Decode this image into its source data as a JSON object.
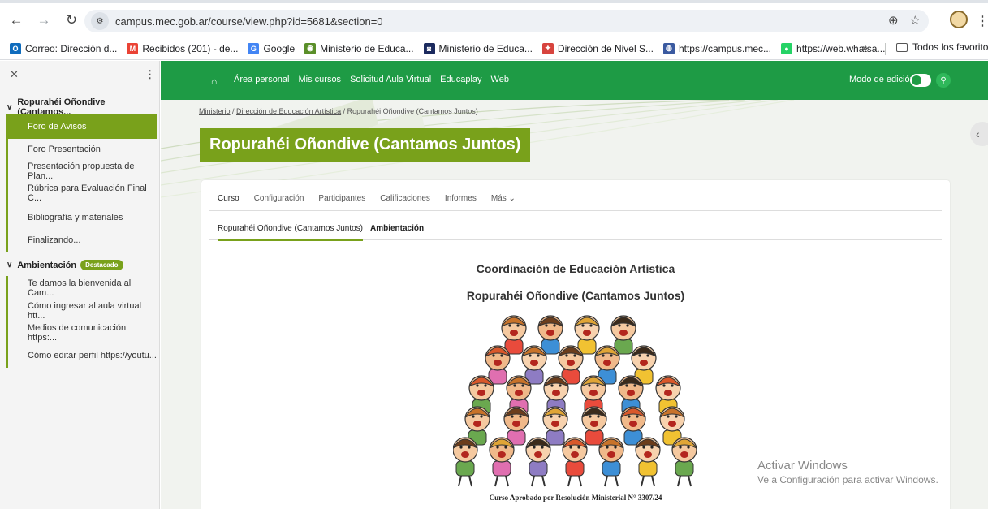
{
  "browser": {
    "url": "campus.mec.gob.ar/course/view.php?id=5681&section=0",
    "bookmarks": [
      {
        "label": "Correo: Dirección d...",
        "color": "#0f6cbd",
        "glyph": "O"
      },
      {
        "label": "Recibidos (201) - de...",
        "color": "#ea4335",
        "glyph": "M"
      },
      {
        "label": "Google",
        "color": "#4285f4",
        "glyph": "G"
      },
      {
        "label": "Ministerio de Educa...",
        "color": "#5a8f29",
        "glyph": "◉"
      },
      {
        "label": "Ministerio de Educa...",
        "color": "#1b2a5e",
        "glyph": "◙"
      },
      {
        "label": "Dirección de Nivel S...",
        "color": "#d7443e",
        "glyph": "✦"
      },
      {
        "label": "https://campus.mec...",
        "color": "#3a5aa0",
        "glyph": "◍"
      },
      {
        "label": "https://web.whatsa...",
        "color": "#25d366",
        "glyph": "●"
      }
    ],
    "bookmarks_more": "»",
    "all_bookmarks": "Todos los favoritos"
  },
  "drawer": {
    "sections": [
      {
        "title": "Ropurahéi Oñondive (Cantamos...",
        "items": [
          "Foro de Avisos",
          "Foro Presentación",
          "Presentación propuesta de Plan...",
          "Rúbrica para Evaluación Final C...",
          "Bibliografía y materiales",
          "Finalizando..."
        ]
      },
      {
        "title": "Ambientación",
        "badge": "Destacado",
        "items": [
          "Te damos la bienvenida al Cam...",
          "Cómo ingresar al aula virtual htt...",
          "Medios de comunicación https:...",
          "Cómo editar perfil https://youtu..."
        ]
      }
    ]
  },
  "navbar": {
    "links": [
      "Área personal",
      "Mis cursos",
      "Solicitud Aula Virtual",
      "Educaplay",
      "Web"
    ],
    "edit_mode": "Modo de edición"
  },
  "breadcrumb": [
    "Ministerio",
    "Dirección de Educación Artística",
    "Ropurahéi Oñondive (Cantamos Juntos)"
  ],
  "page_title": "Ropurahéi Oñondive (Cantamos Juntos)",
  "tabs": [
    "Curso",
    "Configuración",
    "Participantes",
    "Calificaciones",
    "Informes",
    "Más ⌄"
  ],
  "subtabs": [
    "Ropurahéi Oñondive (Cantamos Juntos)",
    "Ambientación"
  ],
  "content": {
    "heading1": "Coordinación de Educación Artística",
    "heading2": "Ropurahéi Oñondive (Cantamos Juntos)",
    "resolution": "Curso Aprobado por Resolución Ministerial N° 3307/24"
  },
  "watermark": {
    "line1": "Activar Windows",
    "line2": "Ve a Configuración para activar Windows."
  },
  "colors": {
    "green_nav": "#1e9b45",
    "olive_accent": "#79a11b"
  }
}
